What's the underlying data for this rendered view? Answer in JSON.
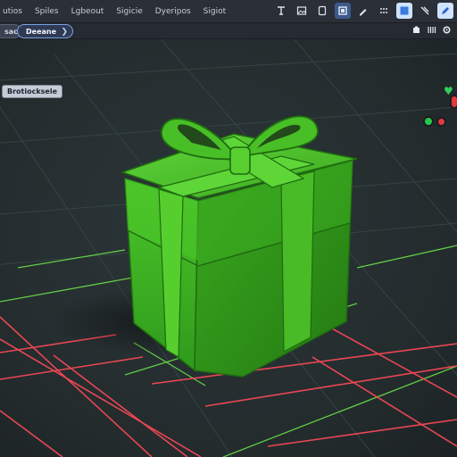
{
  "menu": {
    "items": [
      "utios",
      "Spiles",
      "Lgbeout",
      "Sigicie",
      "Dyeripos",
      "Sigiot"
    ]
  },
  "toolbar": {
    "icons": [
      "text-cursor-icon",
      "image-icon",
      "frame-icon",
      "bookmark-icon",
      "select-box-icon",
      "pen-icon",
      "grid-dots-icon",
      "panel-icon",
      "tools-icon",
      "pencil-icon"
    ]
  },
  "subbar": {
    "left_pill": "sac",
    "main_pill": "Deeane",
    "main_arrow": "❯",
    "right_icons": [
      "puzzle-icon",
      "bars-icon",
      "settings-icon"
    ]
  },
  "scene": {
    "object_label": "Brotiocksele",
    "colors": {
      "gift": "#3fb523",
      "gift_dark": "#2d8d17",
      "ribbon": "#52cf2a",
      "grid_green": "#6ee84a",
      "grid_red": "#ff4a57",
      "grid_dark": "#3a4a48"
    }
  },
  "gizmo": {
    "heart_color": "#2fd05a",
    "dots": [
      "#27c94a",
      "#e23a3a",
      "#e23a3a"
    ]
  }
}
